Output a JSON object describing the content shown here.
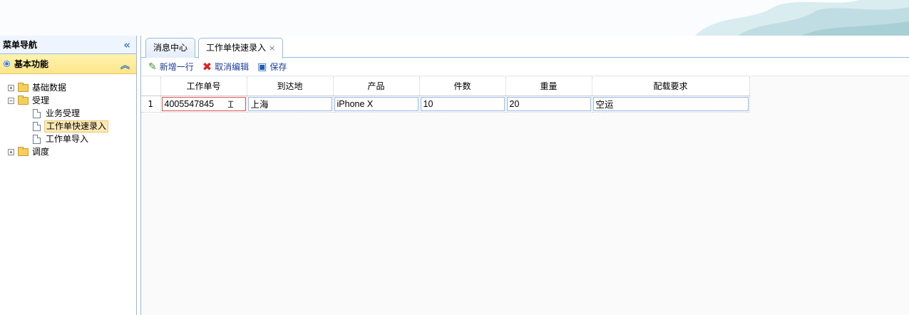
{
  "nav": {
    "title": "菜单导航",
    "section": "基本功能",
    "tree": [
      {
        "label": "基础数据",
        "toggle": "+"
      },
      {
        "label": "受理",
        "toggle": "-"
      },
      {
        "label": "业务受理"
      },
      {
        "label": "工作单快速录入",
        "selected": true
      },
      {
        "label": "工作单导入"
      },
      {
        "label": "调度",
        "toggle": "+"
      }
    ]
  },
  "tabs": [
    {
      "label": "消息中心"
    },
    {
      "label": "工作单快速录入",
      "close": "×"
    }
  ],
  "toolbar": {
    "add": "新增一行",
    "cancel": "取消编辑",
    "save": "保存"
  },
  "grid": {
    "columns": [
      "工作单号",
      "到达地",
      "产品",
      "件数",
      "重量",
      "配载要求"
    ],
    "rows": [
      {
        "num": "1",
        "cells": [
          "4005547845",
          "上海",
          "iPhone X",
          "10",
          "20",
          "空运"
        ]
      }
    ]
  },
  "colors": {
    "accent": "#95b8e7",
    "selected": "#fbe9b7",
    "header_yellow": "#fde58a"
  }
}
